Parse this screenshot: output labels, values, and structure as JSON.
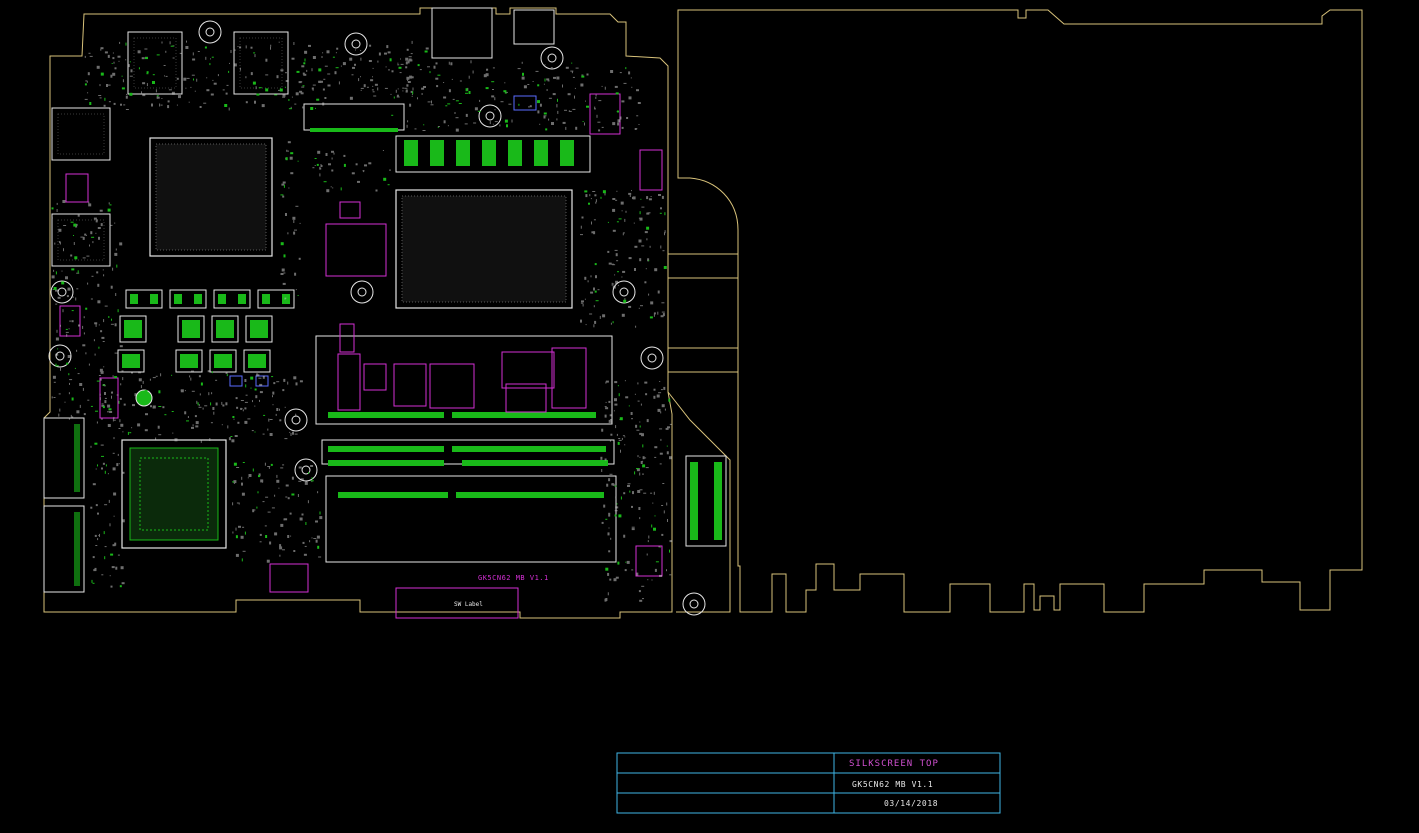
{
  "board": {
    "name_label": "GK5CN62 MB V1.1",
    "sw_label": "SW Label"
  },
  "title_block": {
    "layer": "SILKSCREEN TOP",
    "board": "GK5CN62 MB V1.1",
    "date": "03/14/2018"
  },
  "colors": {
    "background": "#000000",
    "outline": "#d8c27a",
    "silk": "#e6e6e6",
    "pad": "#19b919",
    "magenta": "#d42fd4",
    "title_block": "#3fb6e6",
    "title_text": "#d050d0"
  },
  "icons": [
    "mounting-hole-icon"
  ]
}
